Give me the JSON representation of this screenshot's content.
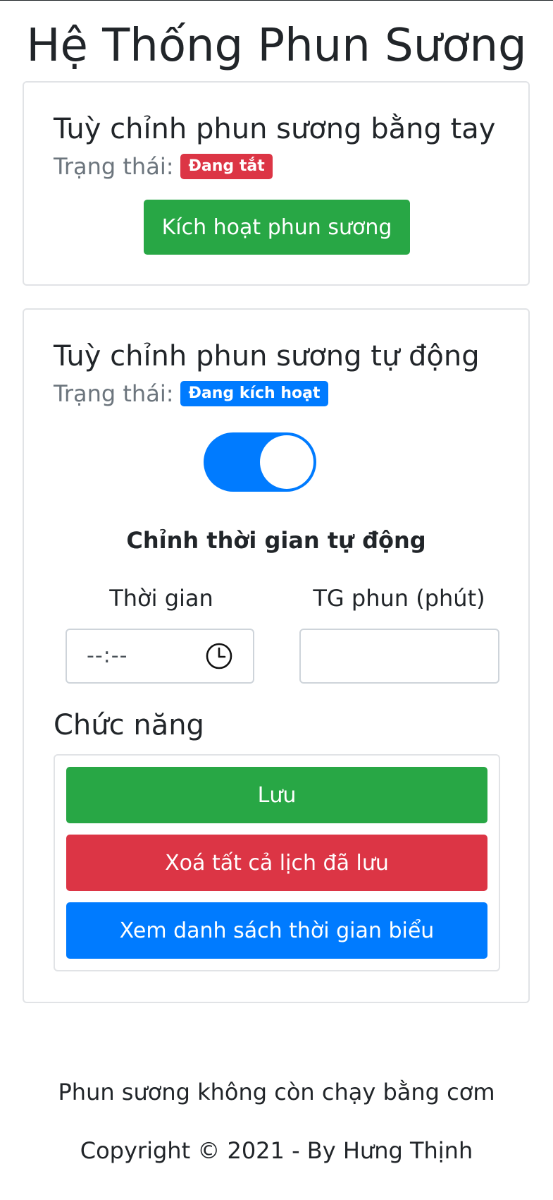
{
  "page": {
    "title": "Hệ Thống Phun Sương"
  },
  "manual": {
    "heading": "Tuỳ chỉnh phun sương bằng tay",
    "status_label": "Trạng thái:",
    "status_badge": "Đang tắt",
    "activate_button": "Kích hoạt phun sương"
  },
  "auto": {
    "heading": "Tuỳ chỉnh phun sương tự động",
    "status_label": "Trạng thái:",
    "status_badge": "Đang kích hoạt",
    "toggle_on": true,
    "schedule_heading": "Chỉnh thời gian tự động",
    "time_label": "Thời gian",
    "time_placeholder": "--:--",
    "duration_label": "TG phun (phút)",
    "duration_value": "",
    "functions_heading": "Chức năng",
    "buttons": {
      "save": "Lưu",
      "clear": "Xoá tất cả lịch đã lưu",
      "view": "Xem danh sách thời gian biểu"
    }
  },
  "footer": {
    "tagline": "Phun sương không còn chạy bằng cơm",
    "copyright": "Copyright © 2021 - By Hưng Thịnh"
  },
  "icons": {
    "time_input": "clock-icon"
  },
  "colors": {
    "success": "#28a745",
    "danger": "#dc3545",
    "primary": "#007bff",
    "muted": "#6c757d"
  }
}
